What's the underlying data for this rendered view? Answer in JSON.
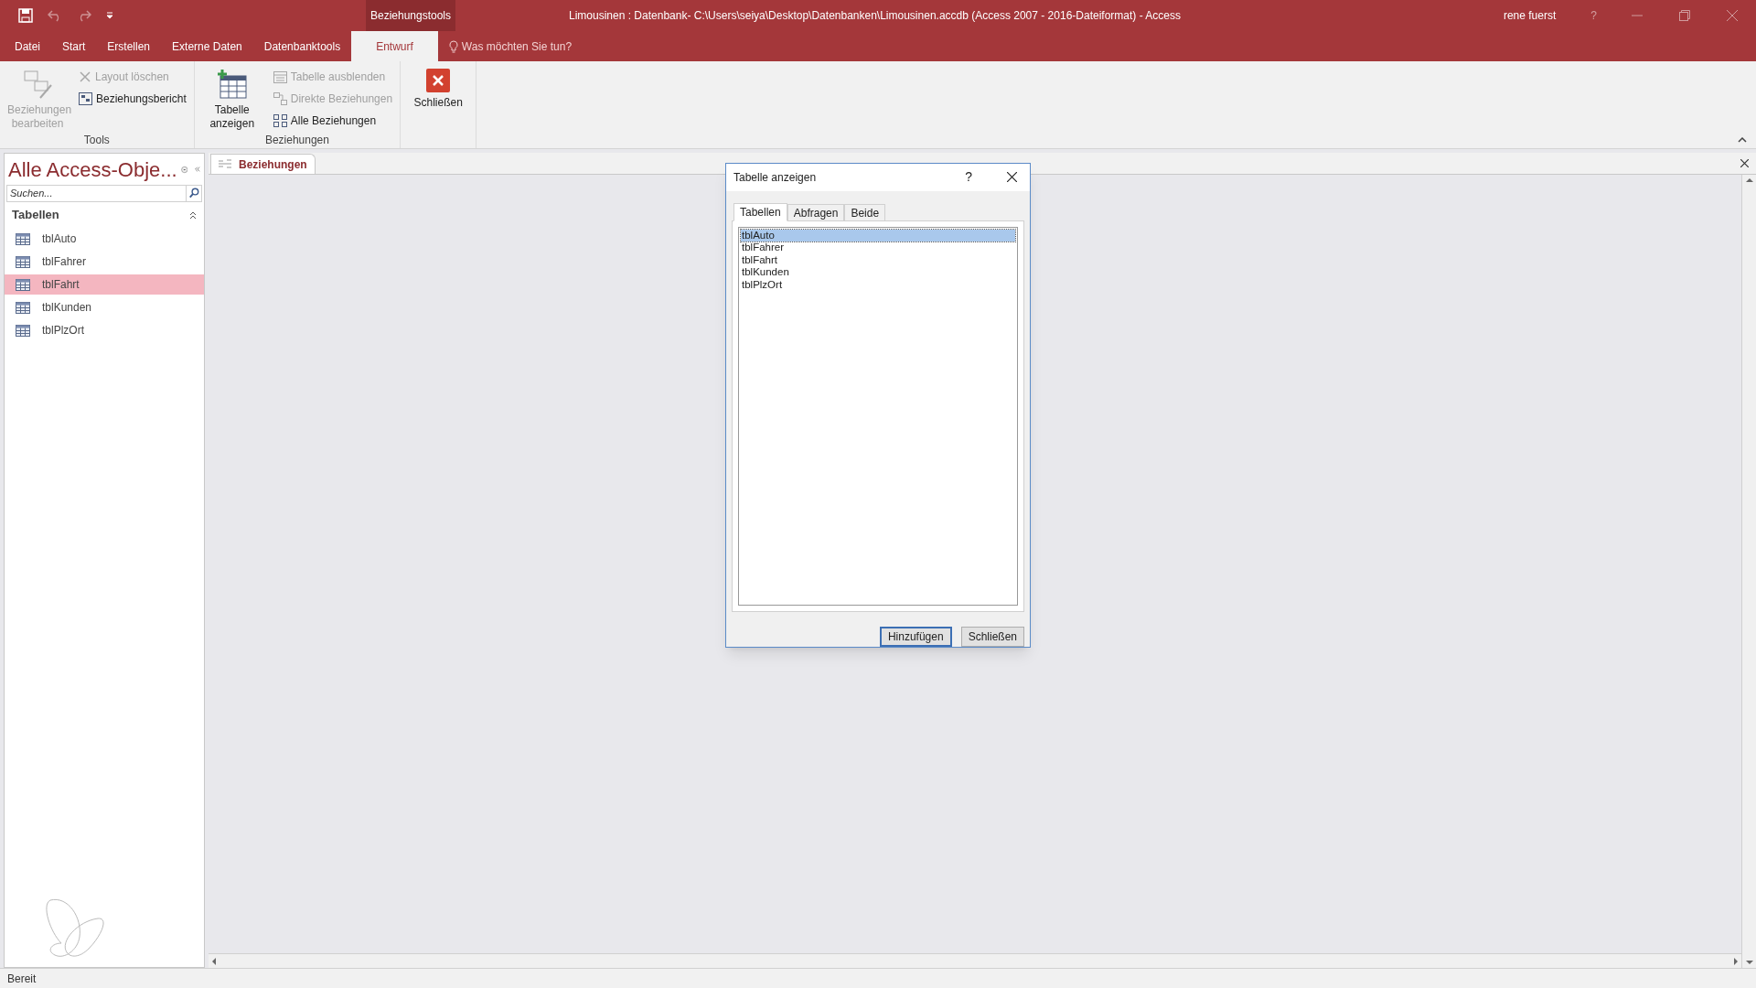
{
  "window": {
    "context_tab": "Beziehungstools",
    "title": "Limousinen : Datenbank- C:\\Users\\seiya\\Desktop\\Datenbanken\\Limousinen.accdb (Access 2007 - 2016-Dateiformat)  -  Access",
    "user": "rene fuerst",
    "help": "?"
  },
  "ribbon_tabs": [
    {
      "label": "Datei",
      "selected": false
    },
    {
      "label": "Start",
      "selected": false
    },
    {
      "label": "Erstellen",
      "selected": false
    },
    {
      "label": "Externe Daten",
      "selected": false
    },
    {
      "label": "Datenbanktools",
      "selected": false
    },
    {
      "label": "Entwurf",
      "selected": true
    }
  ],
  "tell_me": {
    "placeholder": "Was möchten Sie tun?"
  },
  "ribbon_groups": [
    {
      "label": "Tools",
      "items": [
        {
          "kind": "large",
          "label": "Beziehungen bearbeiten",
          "disabled": true
        },
        {
          "kind": "small",
          "label": "Layout löschen",
          "disabled": true
        },
        {
          "kind": "small",
          "label": "Beziehungsbericht",
          "disabled": false
        }
      ]
    },
    {
      "label": "Beziehungen",
      "items": [
        {
          "kind": "large",
          "label": "Tabelle anzeigen",
          "disabled": false
        },
        {
          "kind": "small",
          "label": "Tabelle ausblenden",
          "disabled": true
        },
        {
          "kind": "small",
          "label": "Direkte Beziehungen",
          "disabled": true
        },
        {
          "kind": "small",
          "label": "Alle Beziehungen",
          "disabled": false
        }
      ]
    },
    {
      "items": [
        {
          "kind": "large",
          "label": "Schließen",
          "disabled": false
        }
      ]
    }
  ],
  "nav_pane": {
    "title": "Alle Access-Obje...",
    "search": {
      "placeholder": "Suchen..."
    },
    "section": "Tabellen",
    "items": [
      {
        "label": "tblAuto",
        "selected": false
      },
      {
        "label": "tblFahrer",
        "selected": false
      },
      {
        "label": "tblFahrt",
        "selected": true
      },
      {
        "label": "tblKunden",
        "selected": false
      },
      {
        "label": "tblPlzOrt",
        "selected": false
      }
    ]
  },
  "document_tab": {
    "label": "Beziehungen"
  },
  "dialog": {
    "title": "Tabelle anzeigen",
    "help": "?",
    "tabs": [
      {
        "label": "Tabellen",
        "selected": true
      },
      {
        "label": "Abfragen",
        "selected": false
      },
      {
        "label": "Beide",
        "selected": false
      }
    ],
    "items": [
      {
        "label": "tblAuto",
        "selected": true
      },
      {
        "label": "tblFahrer",
        "selected": false
      },
      {
        "label": "tblFahrt",
        "selected": false
      },
      {
        "label": "tblKunden",
        "selected": false
      },
      {
        "label": "tblPlzOrt",
        "selected": false
      }
    ],
    "buttons": [
      {
        "label": "Hinzufügen",
        "default": true
      },
      {
        "label": "Schließen",
        "default": false
      }
    ]
  },
  "status_bar": {
    "text": "Bereit"
  }
}
